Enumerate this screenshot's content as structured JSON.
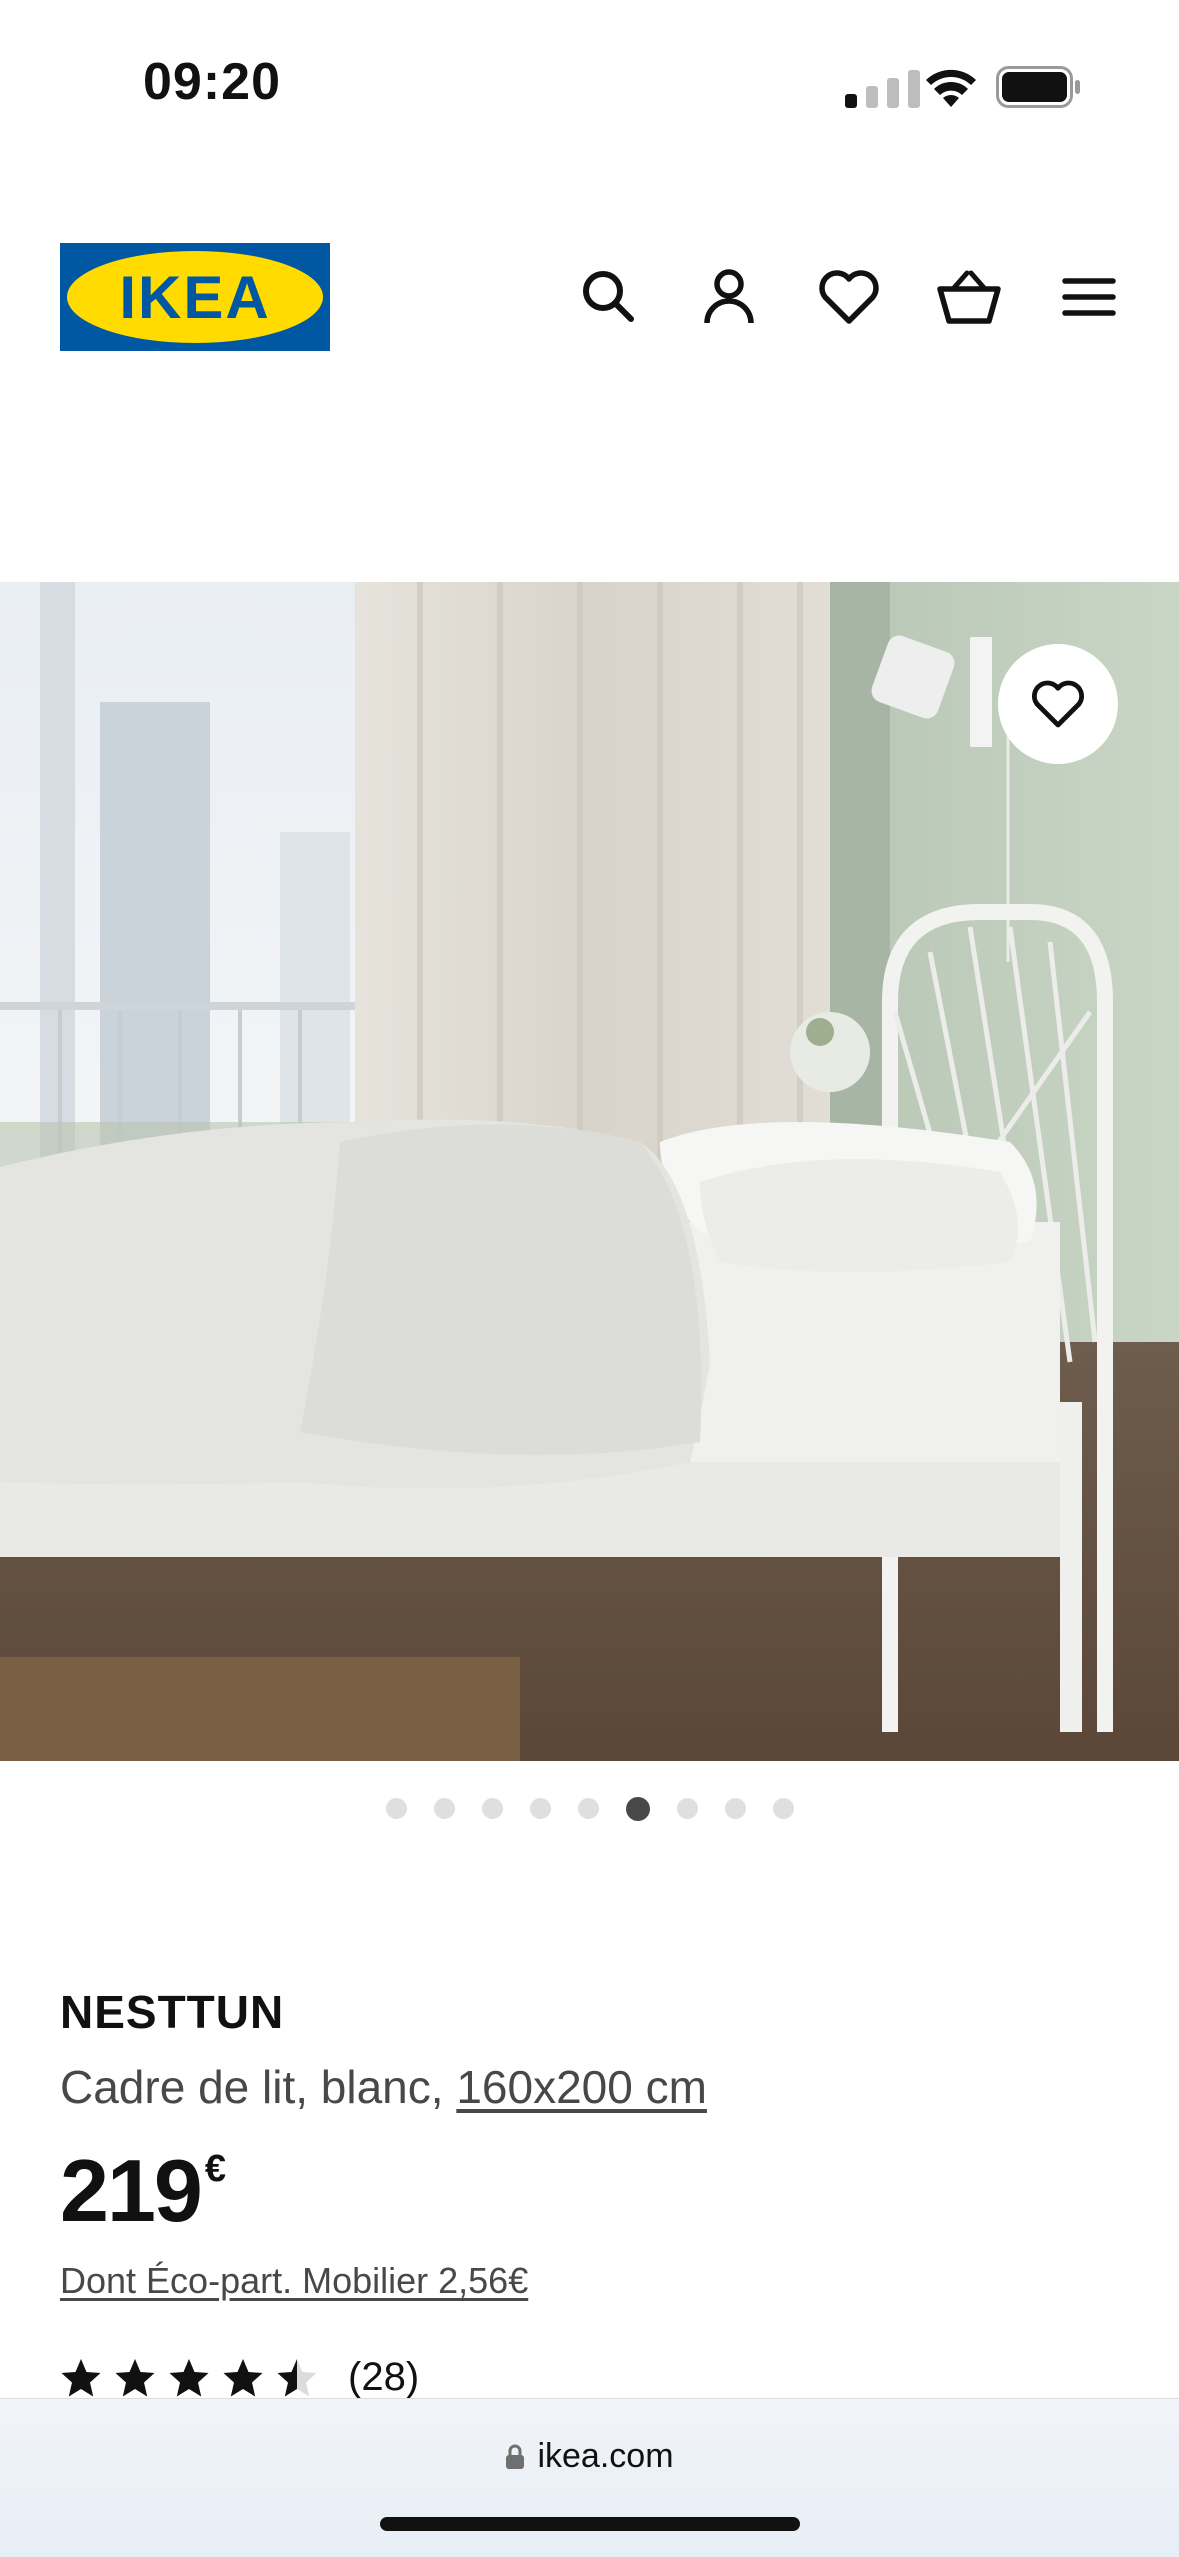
{
  "status_bar": {
    "time": "09:20"
  },
  "header": {
    "logo_text": "IKEA",
    "icons": [
      "search-icon",
      "account-icon",
      "heart-icon",
      "basket-icon",
      "menu-icon"
    ]
  },
  "gallery": {
    "image_count": 9,
    "active_index": 5
  },
  "product": {
    "name": "NESTTUN",
    "description": "Cadre de lit, blanc, ",
    "size_link": "160x200 cm",
    "price": "219",
    "currency": "€",
    "eco_participation": "Dont Éco-part. Mobilier 2,56€",
    "rating_value": 4.5,
    "rating_max": 5,
    "review_count": "(28)"
  },
  "browser": {
    "url": "ikea.com"
  },
  "colors": {
    "ikea_blue": "#0058A3",
    "ikea_yellow": "#FFDB00",
    "wall_green": "#c3d0c0",
    "dot_active": "#484848",
    "dot_inactive": "#dfdfdf"
  }
}
